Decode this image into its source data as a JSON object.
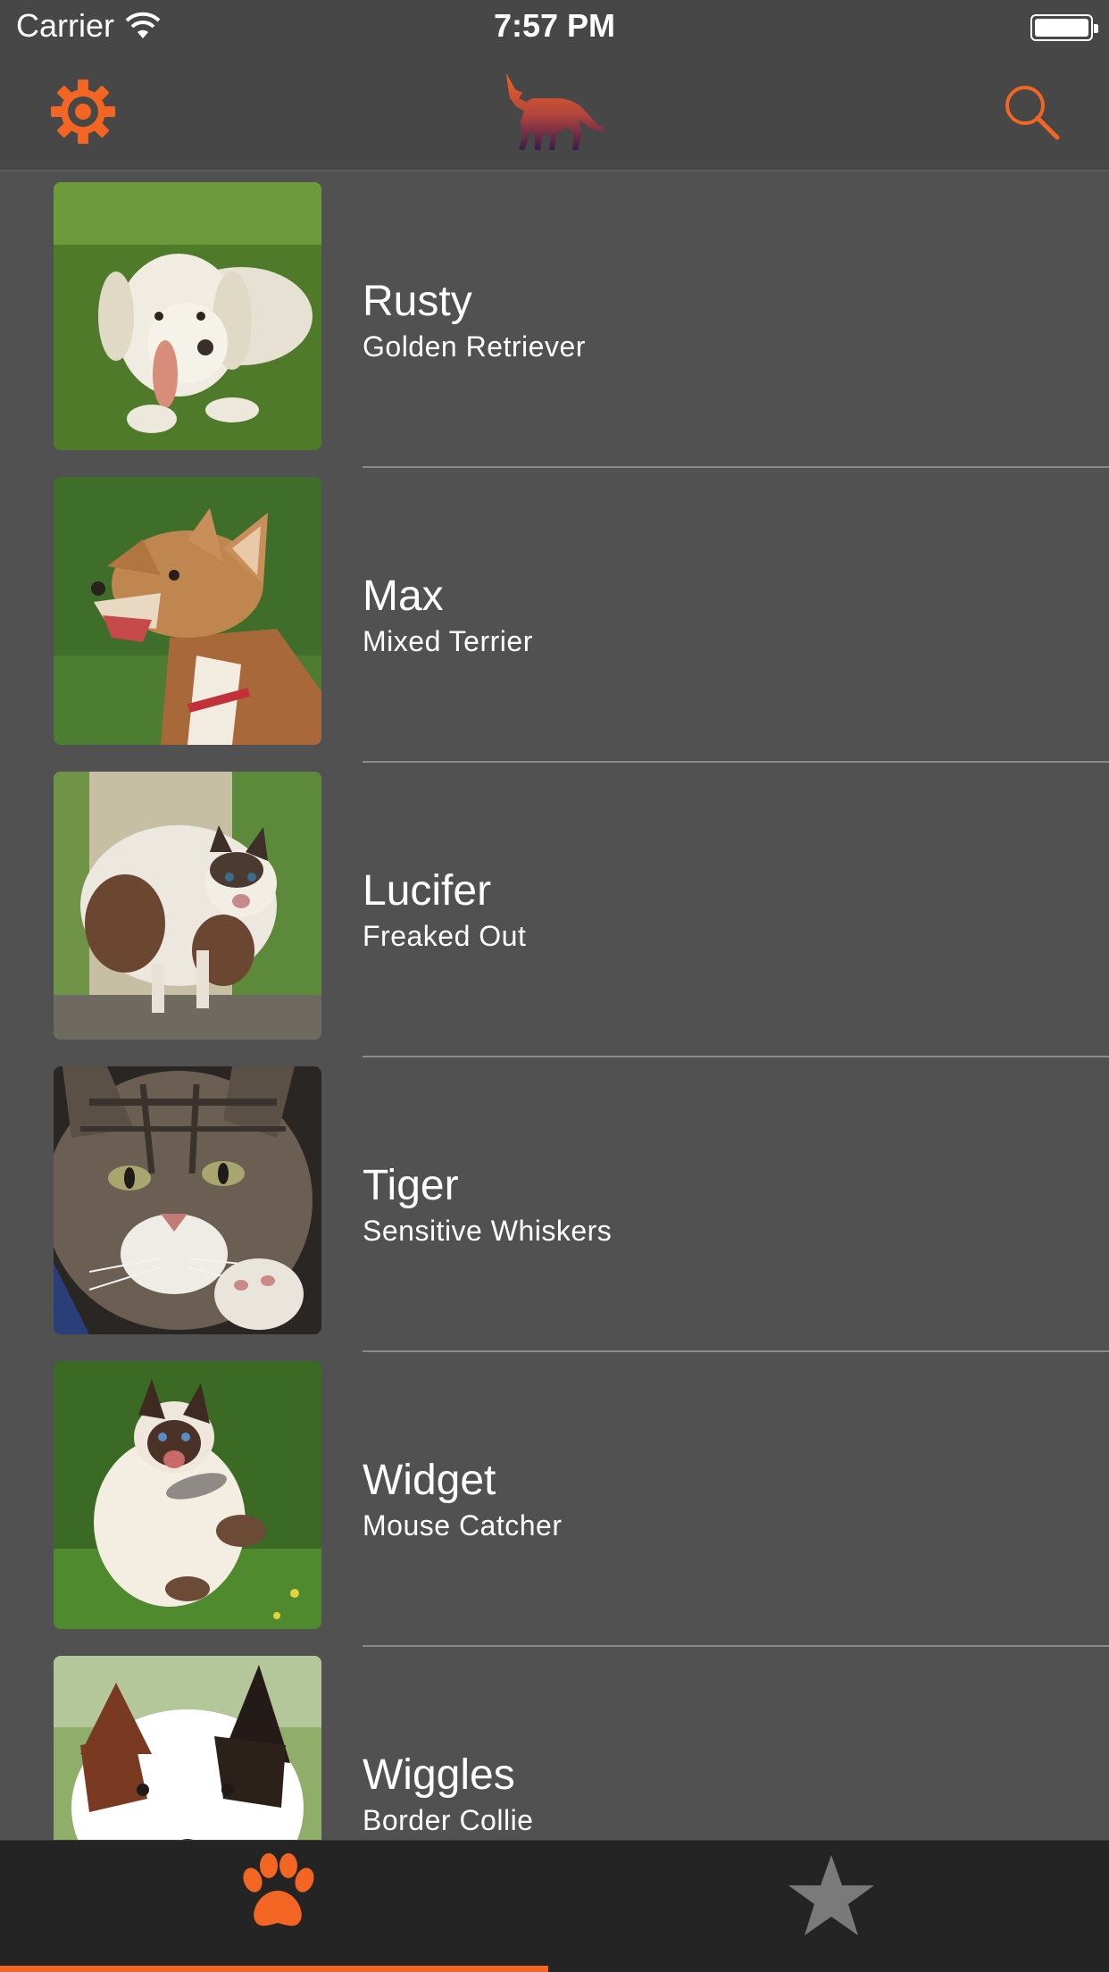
{
  "status_bar": {
    "carrier": "Carrier",
    "time": "7:57 PM"
  },
  "nav": {
    "settings_icon": "gear-icon",
    "logo_icon": "fox-cat-dog-silhouette-logo",
    "search_icon": "search-icon"
  },
  "pets": [
    {
      "name": "Rusty",
      "description": "Golden Retriever",
      "photo": "golden-retriever-photo"
    },
    {
      "name": "Max",
      "description": "Mixed Terrier",
      "photo": "mixed-terrier-photo"
    },
    {
      "name": "Lucifer",
      "description": "Freaked Out",
      "photo": "freaked-out-cat-photo"
    },
    {
      "name": "Tiger",
      "description": "Sensitive Whiskers",
      "photo": "tabby-cat-photo"
    },
    {
      "name": "Widget",
      "description": "Mouse Catcher",
      "photo": "siamese-cat-with-mouse-photo"
    },
    {
      "name": "Wiggles",
      "description": "Border Collie",
      "photo": "border-collie-photo"
    }
  ],
  "tabs": [
    {
      "id": "pets",
      "icon": "paw-icon",
      "selected": true
    },
    {
      "id": "favorites",
      "icon": "star-icon",
      "selected": false
    }
  ],
  "colors": {
    "accent": "#f26522",
    "background": "#515151",
    "nav_background": "#474747",
    "tabbar_background": "#242424",
    "inactive_tab_icon": "#7a7a7a"
  }
}
